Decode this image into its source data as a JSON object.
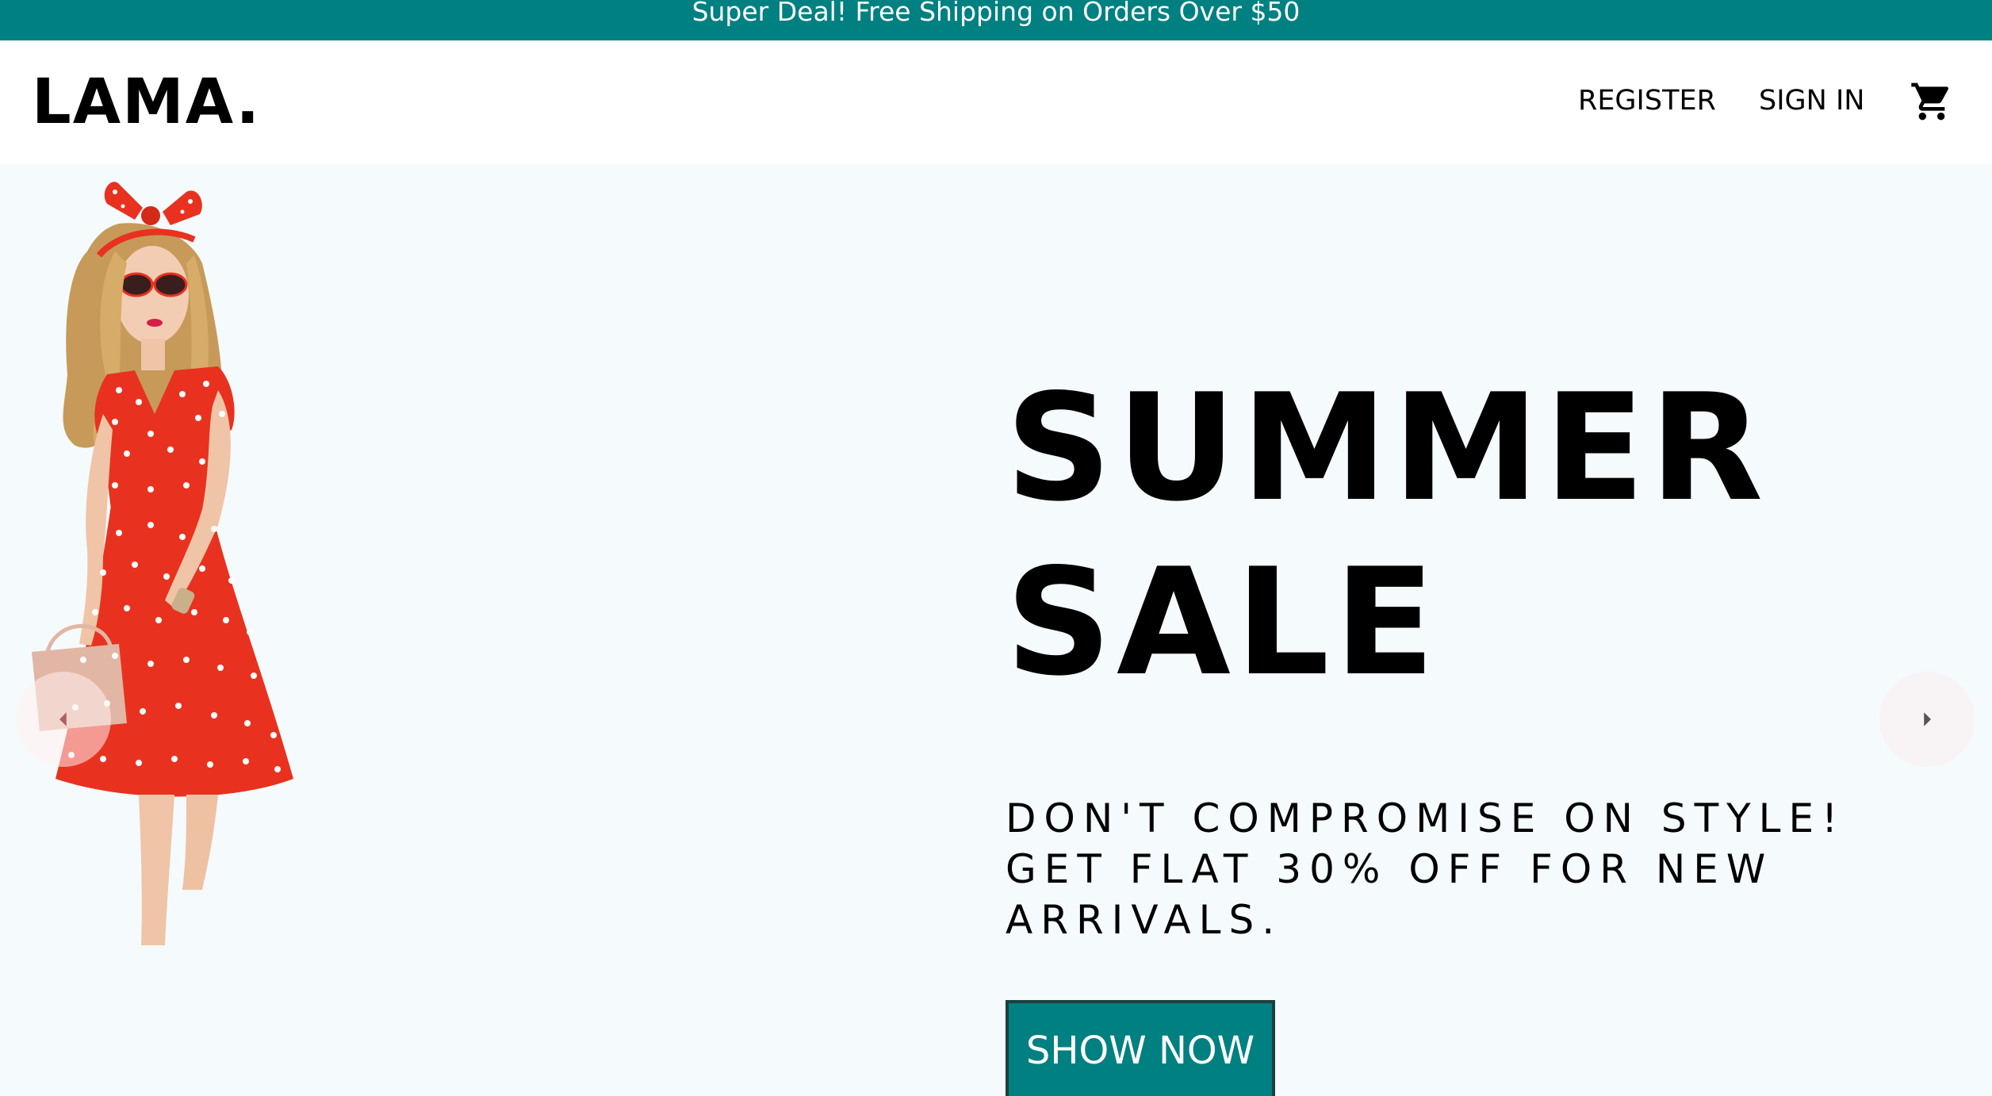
{
  "announcement": {
    "text": "Super Deal! Free Shipping on Orders Over $50"
  },
  "navbar": {
    "logo": "LAMA.",
    "links": {
      "register": "REGISTER",
      "sign_in": "SIGN IN"
    },
    "cart_icon": "shopping-cart-icon"
  },
  "slider": {
    "title_line1": "SUMMER",
    "title_line2": "SALE",
    "description": "DON'T COMPROMISE ON STYLE! GET FLAT 30% OFF FOR NEW ARRIVALS.",
    "button_label": "SHOW NOW",
    "left_arrow_icon": "arrow-left-icon",
    "right_arrow_icon": "arrow-right-icon"
  },
  "colors": {
    "accent": "#008080",
    "hero_background": "#f5fafd",
    "dress_red": "#e8321f"
  }
}
